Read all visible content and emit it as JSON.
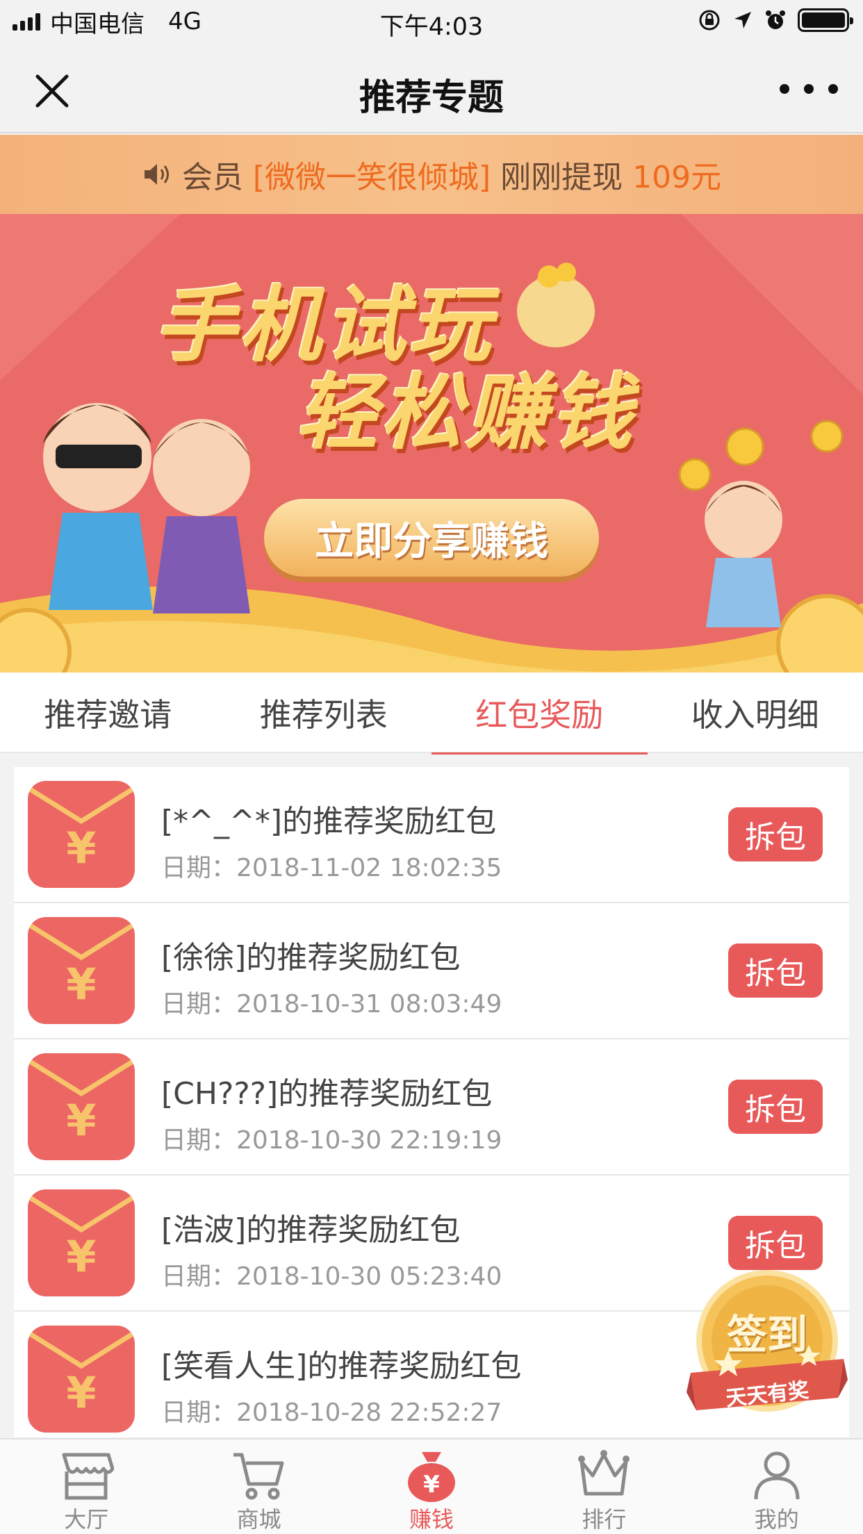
{
  "status_bar": {
    "carrier": "中国电信",
    "network": "4G",
    "time": "下午4:03"
  },
  "nav": {
    "title": "推荐专题"
  },
  "notice": {
    "prefix": "会员",
    "member": "[微微一笑很倾城]",
    "action": "刚刚提现",
    "amount": "109元"
  },
  "banner": {
    "line1": "手机试玩",
    "line2": "轻松赚钱",
    "cta": "立即分享赚钱"
  },
  "tabs": [
    {
      "label": "推荐邀请"
    },
    {
      "label": "推荐列表"
    },
    {
      "label": "红包奖励",
      "active": true
    },
    {
      "label": "收入明细"
    }
  ],
  "list": {
    "button_label": "拆包",
    "items": [
      {
        "title": "[*^_^*]的推荐奖励红包",
        "date": "日期：2018-11-02 18:02:35"
      },
      {
        "title": "[徐徐]的推荐奖励红包",
        "date": "日期：2018-10-31 08:03:49"
      },
      {
        "title": "[CH???]的推荐奖励红包",
        "date": "日期：2018-10-30 22:19:19"
      },
      {
        "title": "[浩波]的推荐奖励红包",
        "date": "日期：2018-10-30 05:23:40"
      },
      {
        "title": "[笑看人生]的推荐奖励红包",
        "date": "日期：2018-10-28 22:52:27"
      }
    ]
  },
  "sign_badge": {
    "title": "签到",
    "subtitle": "天天有奖"
  },
  "tabbar": [
    {
      "label": "大厅",
      "icon": "store-icon"
    },
    {
      "label": "商城",
      "icon": "cart-icon"
    },
    {
      "label": "赚钱",
      "icon": "money-bag-icon",
      "active": true
    },
    {
      "label": "排行",
      "icon": "crown-icon"
    },
    {
      "label": "我的",
      "icon": "user-icon"
    }
  ],
  "colors": {
    "accent": "#e8595a",
    "notice_highlight": "#ee6b1f",
    "envelope": "#ec6663",
    "banner_bg": "#e96a66"
  }
}
